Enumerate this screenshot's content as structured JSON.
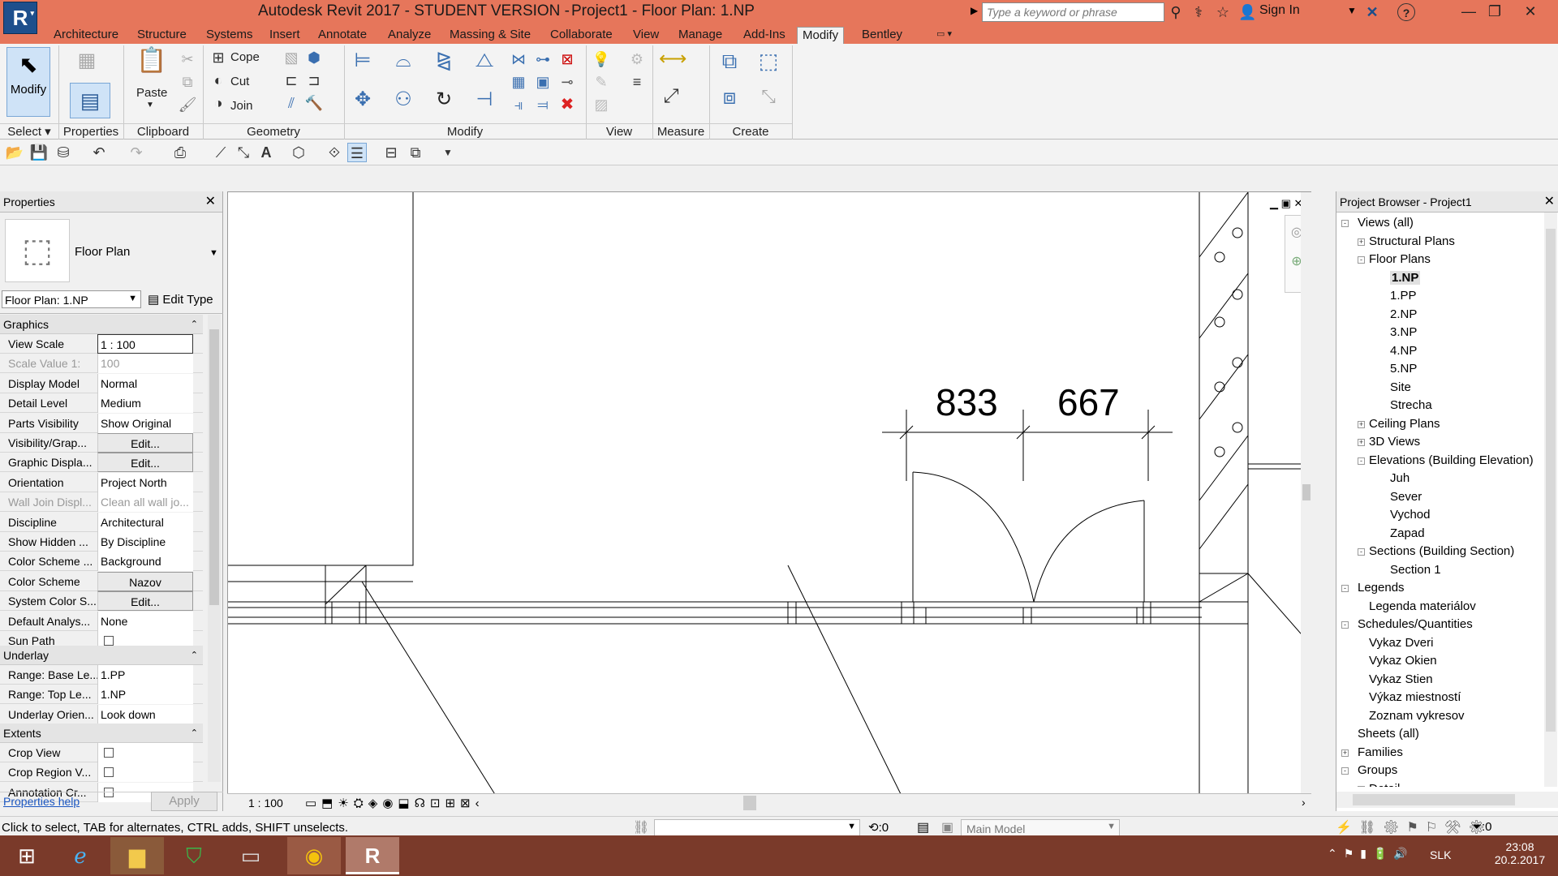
{
  "window": {
    "title": "Autodesk Revit 2017 - STUDENT VERSION -",
    "doc_title": "Project1 - Floor Plan: 1.NP",
    "search_placeholder": "Type a keyword or phrase",
    "sign_in": "Sign In",
    "logo": "R"
  },
  "menu_tabs": [
    "Architecture",
    "Structure",
    "Systems",
    "Insert",
    "Annotate",
    "Analyze",
    "Massing & Site",
    "Collaborate",
    "View",
    "Manage",
    "Add-Ins",
    "Modify",
    "Bentley"
  ],
  "active_tab": "Modify",
  "ribbon": {
    "modify_label": "Modify",
    "paste_label": "Paste",
    "cope_label": "Cope",
    "cut_label": "Cut",
    "join_label": "Join",
    "panels": [
      "Select",
      "Properties",
      "Clipboard",
      "Geometry",
      "Modify",
      "View",
      "Measure",
      "Create"
    ]
  },
  "properties": {
    "title": "Properties",
    "type_name": "Floor Plan",
    "selector": "Floor Plan: 1.NP",
    "edit_type": "Edit Type",
    "sections": {
      "graphics": "Graphics",
      "underlay": "Underlay",
      "extents": "Extents"
    },
    "rows_graphics": [
      {
        "k": "View Scale",
        "v": "1 : 100"
      },
      {
        "k": "Scale Value    1:",
        "v": "100"
      },
      {
        "k": "Display Model",
        "v": "Normal"
      },
      {
        "k": "Detail Level",
        "v": "Medium"
      },
      {
        "k": "Parts Visibility",
        "v": "Show Original"
      },
      {
        "k": "Visibility/Grap...",
        "v": "Edit..."
      },
      {
        "k": "Graphic Displa...",
        "v": "Edit..."
      },
      {
        "k": "Orientation",
        "v": "Project North"
      },
      {
        "k": "Wall Join Displ...",
        "v": "Clean all wall jo..."
      },
      {
        "k": "Discipline",
        "v": "Architectural"
      },
      {
        "k": "Show Hidden ...",
        "v": "By Discipline"
      },
      {
        "k": "Color Scheme ...",
        "v": "Background"
      },
      {
        "k": "Color Scheme",
        "v": "Nazov"
      },
      {
        "k": "System Color S...",
        "v": "Edit..."
      },
      {
        "k": "Default Analys...",
        "v": "None"
      },
      {
        "k": "Sun Path",
        "v": ""
      }
    ],
    "rows_underlay": [
      {
        "k": "Range: Base Le...",
        "v": "1.PP"
      },
      {
        "k": "Range: Top Le...",
        "v": "1.NP"
      },
      {
        "k": "Underlay Orien...",
        "v": "Look down"
      }
    ],
    "rows_extents": [
      {
        "k": "Crop View",
        "v": ""
      },
      {
        "k": "Crop Region V...",
        "v": ""
      },
      {
        "k": "Annotation Cr...",
        "v": ""
      }
    ],
    "help": "Properties help",
    "apply": "Apply"
  },
  "canvas": {
    "dim1": "833",
    "dim2": "667",
    "scale": "1 : 100"
  },
  "browser": {
    "title": "Project Browser - Project1",
    "items": [
      {
        "label": "Views (all)",
        "level": 0,
        "box": "-"
      },
      {
        "label": "Structural Plans",
        "level": 1,
        "box": "+"
      },
      {
        "label": "Floor Plans",
        "level": 1,
        "box": "-"
      },
      {
        "label": "1.NP",
        "level": 2,
        "box": "",
        "bold": true
      },
      {
        "label": "1.PP",
        "level": 2,
        "box": ""
      },
      {
        "label": "2.NP",
        "level": 2,
        "box": ""
      },
      {
        "label": "3.NP",
        "level": 2,
        "box": ""
      },
      {
        "label": "4.NP",
        "level": 2,
        "box": ""
      },
      {
        "label": "5.NP",
        "level": 2,
        "box": ""
      },
      {
        "label": "Site",
        "level": 2,
        "box": ""
      },
      {
        "label": "Strecha",
        "level": 2,
        "box": ""
      },
      {
        "label": "Ceiling Plans",
        "level": 1,
        "box": "+"
      },
      {
        "label": "3D Views",
        "level": 1,
        "box": "+"
      },
      {
        "label": "Elevations (Building Elevation)",
        "level": 1,
        "box": "-"
      },
      {
        "label": "Juh",
        "level": 2,
        "box": ""
      },
      {
        "label": "Sever",
        "level": 2,
        "box": ""
      },
      {
        "label": "Vychod",
        "level": 2,
        "box": ""
      },
      {
        "label": "Zapad",
        "level": 2,
        "box": ""
      },
      {
        "label": "Sections (Building Section)",
        "level": 1,
        "box": "-"
      },
      {
        "label": "Section 1",
        "level": 2,
        "box": ""
      },
      {
        "label": "Legends",
        "level": 0,
        "box": "-"
      },
      {
        "label": "Legenda materiálov",
        "level": 1,
        "box": ""
      },
      {
        "label": "Schedules/Quantities",
        "level": 0,
        "box": "-"
      },
      {
        "label": "Vykaz Dveri",
        "level": 1,
        "box": ""
      },
      {
        "label": "Vykaz Okien",
        "level": 1,
        "box": ""
      },
      {
        "label": "Vykaz Stien",
        "level": 1,
        "box": ""
      },
      {
        "label": "Výkaz miestností",
        "level": 1,
        "box": ""
      },
      {
        "label": "Zoznam vykresov",
        "level": 1,
        "box": ""
      },
      {
        "label": "Sheets (all)",
        "level": 0,
        "box": ""
      },
      {
        "label": "Families",
        "level": 0,
        "box": "+"
      },
      {
        "label": "Groups",
        "level": 0,
        "box": "-"
      },
      {
        "label": "Detail",
        "level": 1,
        "box": "-"
      }
    ]
  },
  "status": {
    "message": "Click to select, TAB for alternates, CTRL adds, SHIFT unselects.",
    "zero1": ":0",
    "model": "Main Model",
    "zero2": ":0"
  },
  "taskbar": {
    "lang": "SLK",
    "time": "23:08",
    "date": "20.2.2017"
  }
}
